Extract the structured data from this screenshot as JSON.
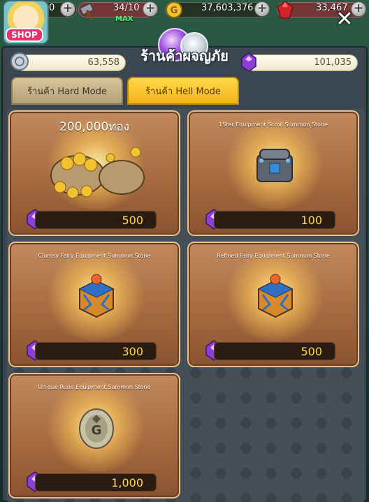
{
  "hud": {
    "level_fragment": "0",
    "stamina": "34/10",
    "stamina_note": "MAX",
    "gold": "37,603,376",
    "gems": "33,467",
    "shop_badge": "SHOP"
  },
  "panel": {
    "title": "ร้านค้าผจญภัย",
    "currency_left": "63,558",
    "currency_right": "101,035",
    "tabs": [
      {
        "label": "ร้านค้า Hard Mode",
        "active": false
      },
      {
        "label": "ร้านค้า Hell Mode",
        "active": true
      }
    ]
  },
  "items": [
    {
      "name": "200,000ทอง",
      "price": "500",
      "icon": "gold-bags-icon"
    },
    {
      "name": "1Star Equipment Scroll Summon Stone",
      "price": "100",
      "icon": "iron-chest-icon"
    },
    {
      "name": "Clumsy Fairy Equipment Summon Stone",
      "price": "300",
      "icon": "ornate-box-icon"
    },
    {
      "name": "Refined Fairy Equipment Summon Stone",
      "price": "500",
      "icon": "ornate-box-icon"
    },
    {
      "name": "Un que Rune Equipment Summon Stone",
      "price": "1,000",
      "icon": "rune-stone-icon"
    }
  ],
  "colors": {
    "price_text": "#ffd84a",
    "active_tab": "#f4b21a",
    "card_bg": "#a3683d"
  }
}
